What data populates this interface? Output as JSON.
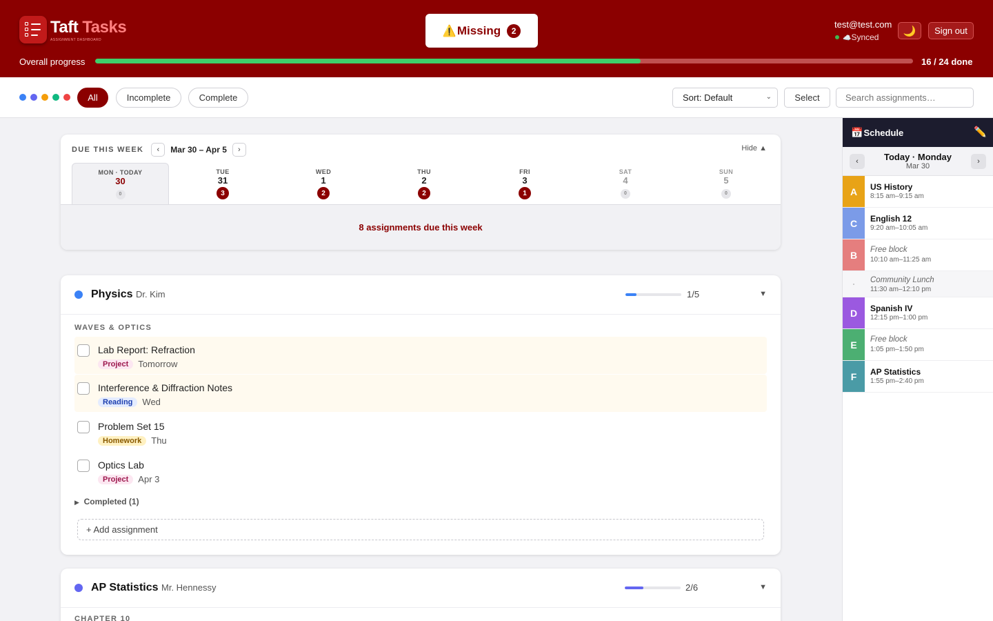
{
  "app": {
    "title_main": "Taft",
    "title_accent": "Tasks",
    "subtitle": "ASSIGNMENT DASHBOARD"
  },
  "header": {
    "missing_label": "Missing",
    "missing_count": "2",
    "missing_icon": "warning-icon",
    "user_email": "test@test.com",
    "sync_status": "Synced",
    "sync_icon": "cloud-icon",
    "theme_icon": "moon-icon",
    "signout_label": "Sign out",
    "progress_label": "Overall progress",
    "progress_done": 16,
    "progress_total": 24,
    "progress_text": "16 / 24 done"
  },
  "filters": {
    "color_dots": [
      "#3b82f6",
      "#6366f1",
      "#f59e0b",
      "#10b981",
      "#ef4444"
    ],
    "all": "All",
    "incomplete": "Incomplete",
    "complete": "Complete",
    "sort_label": "Sort: Default",
    "select_label": "Select",
    "search_placeholder": "Search assignments…"
  },
  "week": {
    "label": "DUE THIS WEEK",
    "range": "Mar 30 – Apr 5",
    "hide_label": "Hide ▲",
    "days": [
      {
        "name": "MON · TODAY",
        "num": "30",
        "count": "0",
        "today": true,
        "weekend": false
      },
      {
        "name": "TUE",
        "num": "31",
        "count": "3",
        "today": false,
        "weekend": false
      },
      {
        "name": "WED",
        "num": "1",
        "count": "2",
        "today": false,
        "weekend": false
      },
      {
        "name": "THU",
        "num": "2",
        "count": "2",
        "today": false,
        "weekend": false
      },
      {
        "name": "FRI",
        "num": "3",
        "count": "1",
        "today": false,
        "weekend": false
      },
      {
        "name": "SAT",
        "num": "4",
        "count": "0",
        "today": false,
        "weekend": true
      },
      {
        "name": "SUN",
        "num": "5",
        "count": "0",
        "today": false,
        "weekend": true
      }
    ],
    "summary": "8 assignments due this week"
  },
  "physics": {
    "color": "#3b82f6",
    "name": "Physics",
    "teacher": "Dr. Kim",
    "done": 1,
    "total": 5,
    "count_text": "1/5",
    "unit": "WAVES & OPTICS",
    "tasks": [
      {
        "title": "Lab Report: Refraction",
        "tag": "Project",
        "tag_type": "project",
        "due": "Tomorrow",
        "soon": true
      },
      {
        "title": "Interference & Diffraction Notes",
        "tag": "Reading",
        "tag_type": "reading",
        "due": "Wed",
        "soon": true
      },
      {
        "title": "Problem Set 15",
        "tag": "Homework",
        "tag_type": "homework",
        "due": "Thu",
        "soon": false
      },
      {
        "title": "Optics Lab",
        "tag": "Project",
        "tag_type": "project",
        "due": "Apr 3",
        "soon": false
      }
    ],
    "completed_label": "Completed (1)",
    "add_label": "+ Add assignment"
  },
  "stats": {
    "color": "#6366f1",
    "name": "AP Statistics",
    "teacher": "Mr. Hennessy",
    "done": 2,
    "total": 6,
    "count_text": "2/6",
    "unit": "CHAPTER 10"
  },
  "schedule": {
    "title": "Schedule",
    "title_icon": "calendar-icon",
    "edit_icon": "pencil-icon",
    "day_title": "Today · Monday",
    "day_date": "Mar 30",
    "periods": [
      {
        "letter": "A",
        "name": "US History",
        "time": "8:15 am–9:15 am",
        "color": "#e8a317",
        "kind": "class"
      },
      {
        "letter": "C",
        "name": "English 12",
        "time": "9:20 am–10:05 am",
        "color": "#7b9be8",
        "kind": "class"
      },
      {
        "letter": "B",
        "name": "Free block",
        "time": "10:10 am–11:25 am",
        "color": "#e57e7e",
        "kind": "free"
      },
      {
        "letter": "",
        "name": "Community Lunch",
        "time": "11:30 am–12:10 pm",
        "color": "",
        "kind": "lunch"
      },
      {
        "letter": "D",
        "name": "Spanish IV",
        "time": "12:15 pm–1:00 pm",
        "color": "#9b59e0",
        "kind": "class"
      },
      {
        "letter": "E",
        "name": "Free block",
        "time": "1:05 pm–1:50 pm",
        "color": "#4caf72",
        "kind": "free"
      },
      {
        "letter": "F",
        "name": "AP Statistics",
        "time": "1:55 pm–2:40 pm",
        "color": "#4a9ba6",
        "kind": "class"
      }
    ]
  }
}
